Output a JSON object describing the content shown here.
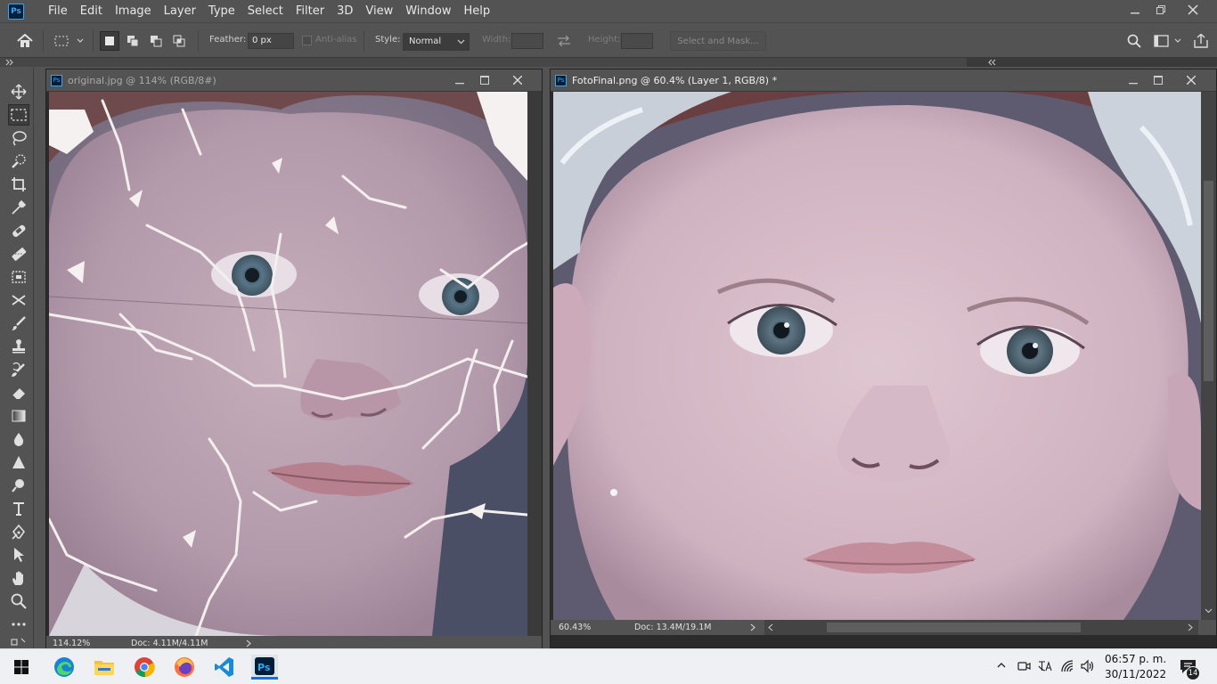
{
  "app": {
    "logo": "Ps"
  },
  "menu": [
    "File",
    "Edit",
    "Image",
    "Layer",
    "Type",
    "Select",
    "Filter",
    "3D",
    "View",
    "Window",
    "Help"
  ],
  "options": {
    "feather_label": "Feather:",
    "feather_value": "0 px",
    "antialias_label": "Anti-alias",
    "style_label": "Style:",
    "style_value": "Normal",
    "width_label": "Width:",
    "height_label": "Height:",
    "select_mask": "Select and Mask..."
  },
  "doc_left": {
    "title": "original.jpg @ 114% (RGB/8#)",
    "zoom": "114.12%",
    "doc": "Doc: 4.11M/4.11M"
  },
  "doc_right": {
    "title": "FotoFinal.png @ 60.4% (Layer 1, RGB/8) *",
    "zoom": "60.43%",
    "doc": "Doc: 13.4M/19.1M"
  },
  "taskbar": {
    "time": "06:57 p. m.",
    "date": "30/11/2022",
    "notifications": "14"
  },
  "tools": [
    "move-tool",
    "marquee-tool",
    "lasso-tool",
    "quick-select-tool",
    "crop-tool",
    "eyedropper-tool",
    "healing-tool",
    "brush-patch-tool",
    "clone-tool",
    "content-move-tool",
    "brush-tool",
    "stamp-tool",
    "history-brush-tool",
    "eraser-tool",
    "gradient-tool",
    "blur-tool",
    "dodge-tool",
    "pen-tool",
    "type-tool",
    "path-select-tool",
    "direct-select-tool",
    "hand-tool",
    "zoom-tool",
    "more-tools"
  ],
  "colors": {
    "ui_bg": "#535353",
    "ps_blue": "#31a8ff"
  }
}
